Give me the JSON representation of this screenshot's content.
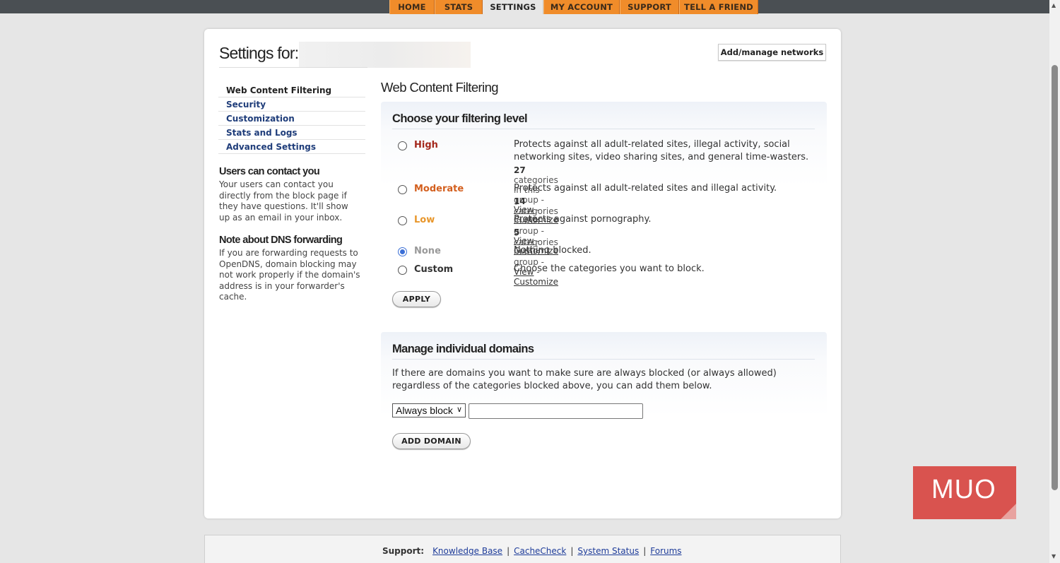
{
  "nav": {
    "tabs": [
      {
        "label": "HOME"
      },
      {
        "label": "STATS"
      },
      {
        "label": "SETTINGS",
        "active": true
      },
      {
        "label": "MY ACCOUNT"
      },
      {
        "label": "SUPPORT"
      },
      {
        "label": "TELL A FRIEND"
      }
    ]
  },
  "header": {
    "title": "Settings for:",
    "manage_networks_label": "Add/manage networks"
  },
  "sidebar": {
    "items": [
      {
        "label": "Web Content Filtering",
        "active": true
      },
      {
        "label": "Security"
      },
      {
        "label": "Customization"
      },
      {
        "label": "Stats and Logs"
      },
      {
        "label": "Advanced Settings"
      }
    ],
    "contact": {
      "heading": "Users can contact you",
      "text": "Your users can contact you directly from the block page if they have questions. It'll show up as an email in your inbox."
    },
    "dns": {
      "heading": "Note about DNS forwarding",
      "text": "If you are forwarding requests to OpenDNS, domain blocking may not work properly if the domain's address is in your forwarder's cache."
    }
  },
  "main": {
    "title": "Web Content Filtering",
    "filtering": {
      "heading": "Choose your filtering level",
      "levels": [
        {
          "label": "High",
          "color": "#a4281c",
          "description": "Protects against all adult-related sites, illegal activity, social networking sites, video sharing sites, and general time-wasters.",
          "count": "27",
          "meta_text": " categories in this group - ",
          "view": "View",
          "sep": " - ",
          "customize": "Customize",
          "checked": false
        },
        {
          "label": "Moderate",
          "color": "#d35f1e",
          "description": "Protects against all adult-related sites and illegal activity.",
          "count": "14",
          "meta_text": " categories in this group - ",
          "view": "View",
          "sep": " - ",
          "customize": "Customize",
          "checked": false
        },
        {
          "label": "Low",
          "color": "#e8962a",
          "description": "Protects against pornography.",
          "count": "5",
          "meta_text": " categories in this group - ",
          "view": "View",
          "sep": " - ",
          "customize": "Customize",
          "checked": false
        },
        {
          "label": "None",
          "color": "#999999",
          "description": "Nothing blocked.",
          "checked": true
        },
        {
          "label": "Custom",
          "color": "#333333",
          "description": "Choose the categories you want to block.",
          "checked": false
        }
      ],
      "apply_label": "APPLY"
    },
    "domains": {
      "heading": "Manage individual domains",
      "text": "If there are domains you want to make sure are always blocked (or always allowed) regardless of the categories blocked above, you can add them below.",
      "select_value": "Always block",
      "input_value": "",
      "add_label": "ADD DOMAIN"
    }
  },
  "footer": {
    "label": "Support:",
    "links": [
      "Knowledge Base",
      "CacheCheck",
      "System Status",
      "Forums"
    ],
    "separator": "|"
  },
  "watermark": {
    "text": "MUO"
  }
}
